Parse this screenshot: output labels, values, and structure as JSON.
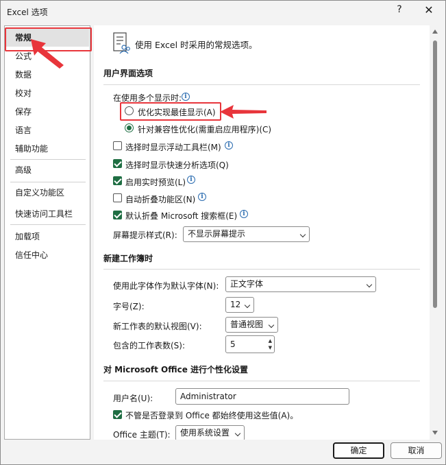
{
  "window": {
    "title": "Excel 选项",
    "help": "?",
    "close": "✕"
  },
  "nav": {
    "items": [
      "常规",
      "公式",
      "数据",
      "校对",
      "保存",
      "语言",
      "辅助功能",
      "高级",
      "自定义功能区",
      "快速访问工具栏",
      "加载项",
      "信任中心"
    ],
    "selected": "常规"
  },
  "header": {
    "text": "使用 Excel 时采用的常规选项。",
    "icon": "options-people-icon"
  },
  "ui_options": {
    "title": "用户界面选项",
    "multi_display_label": "在使用多个显示时:",
    "radio_optimize": "优化实现最佳显示(A)",
    "radio_compat": "针对兼容性优化(需重启应用程序)(C)",
    "cb_mini_toolbar": "选择时显示浮动工具栏(M)",
    "cb_quick_analysis": "选择时显示快速分析选项(Q)",
    "cb_live_preview": "启用实时预览(L)",
    "cb_collapse_ribbon": "自动折叠功能区(N)",
    "cb_search_box": "默认折叠 Microsoft 搜索框(E)",
    "screentip_label": "屏幕提示样式(R):",
    "screentip_value": "不显示屏幕提示"
  },
  "new_workbook": {
    "title": "新建工作簿时",
    "font_label": "使用此字体作为默认字体(N):",
    "font_value": "正文字体",
    "size_label": "字号(Z):",
    "size_value": "12",
    "view_label": "新工作表的默认视图(V):",
    "view_value": "普通视图",
    "sheets_label": "包含的工作表数(S):",
    "sheets_value": "5"
  },
  "personalize": {
    "title": "对 Microsoft Office 进行个性化设置",
    "username_label": "用户名(U):",
    "username_value": "Administrator",
    "cb_always_use": "不管是否登录到 Office 都始终使用这些值(A)。",
    "theme_label": "Office 主题(T):",
    "theme_value": "使用系统设置"
  },
  "buttons": {
    "ok": "确定",
    "cancel": "取消"
  },
  "colors": {
    "accent": "#1f6e43",
    "highlight": "#e8353b",
    "info": "#2b6cb0"
  }
}
